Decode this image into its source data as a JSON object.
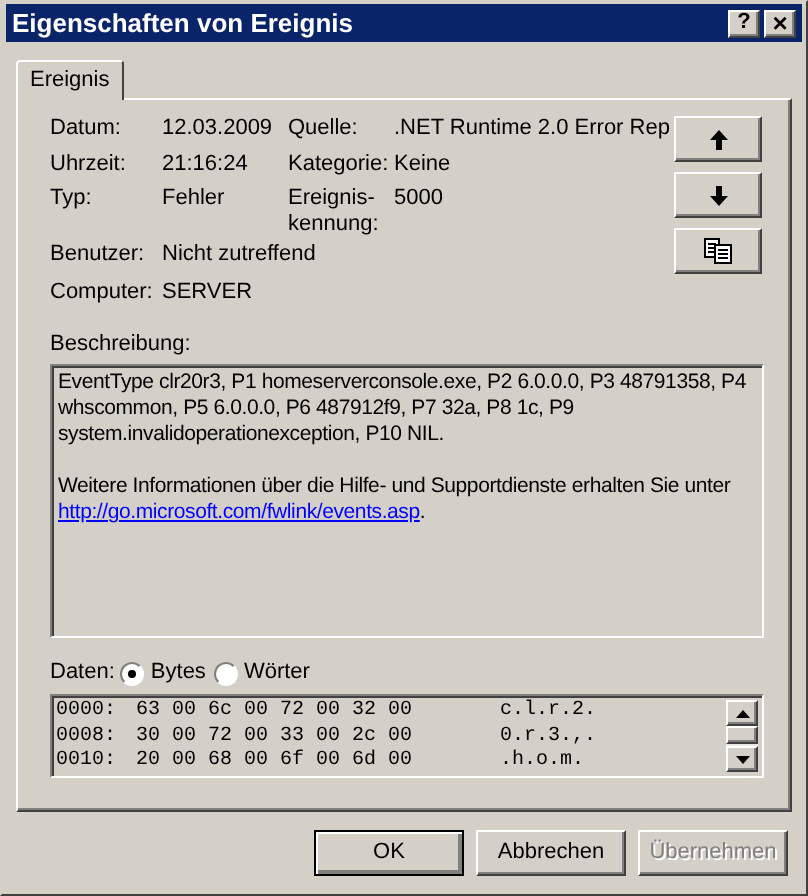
{
  "window": {
    "title": "Eigenschaften von Ereignis",
    "title_buttons": [
      {
        "kind": "help",
        "label": "?"
      },
      {
        "kind": "close",
        "label": "×"
      }
    ]
  },
  "tabs": [
    {
      "label": "Ereignis",
      "selected": true
    }
  ],
  "fields": [
    {
      "label": "Datum:",
      "value": "12.03.2009"
    },
    {
      "label": "Quelle:",
      "value": ".NET Runtime 2.0 Error Rep"
    },
    {
      "label": "Uhrzeit:",
      "value": "21:16:24"
    },
    {
      "label": "Kategorie:",
      "value": "Keine"
    },
    {
      "label": "Typ:",
      "value": "Fehler"
    },
    {
      "label": "Ereignis-\nkennung:",
      "value": "5000"
    },
    {
      "label": "Benutzer:",
      "value": "Nicht zutreffend"
    },
    {
      "label": "Computer:",
      "value": "SERVER"
    }
  ],
  "side_buttons": [
    {
      "kind": "up"
    },
    {
      "kind": "down"
    },
    {
      "kind": "copy"
    }
  ],
  "description": {
    "label": "Beschreibung:",
    "paragraph_1": "EventType clr20r3, P1 homeserverconsole.exe, P2 6.0.0.0, P3 48791358, P4 whscommon, P5 6.0.0.0, P6 487912f9, P7 32a, P8 1c, P9 system.invalidoperationexception, P10 NIL.",
    "paragraph_2": "Weitere Informationen über die Hilfe- und Supportdienste erhalten Sie unter",
    "link": "http://go.microsoft.com/fwlink/events.asp",
    "paragraph_2_end": "."
  },
  "data": {
    "label": "Daten:",
    "options": [
      {
        "label": "Bytes",
        "selected": true
      },
      {
        "label": "Wörter",
        "selected": false
      }
    ],
    "rows": [
      {
        "offset": "0000:",
        "hex": "63 00 6c 00 72 00 32 00",
        "ascii": "c.l.r.2."
      },
      {
        "offset": "0008:",
        "hex": "30 00 72 00 33 00 2c 00",
        "ascii": "0.r.3.,."
      },
      {
        "offset": "0010:",
        "hex": "20 00 68 00 6f 00 6d 00",
        "ascii": ".h.o.m."
      }
    ]
  },
  "buttons": [
    {
      "label": "OK",
      "default": true,
      "disabled": false
    },
    {
      "label": "Abbrechen",
      "default": false,
      "disabled": false
    },
    {
      "label": "Übernehmen",
      "default": false,
      "disabled": true
    }
  ]
}
